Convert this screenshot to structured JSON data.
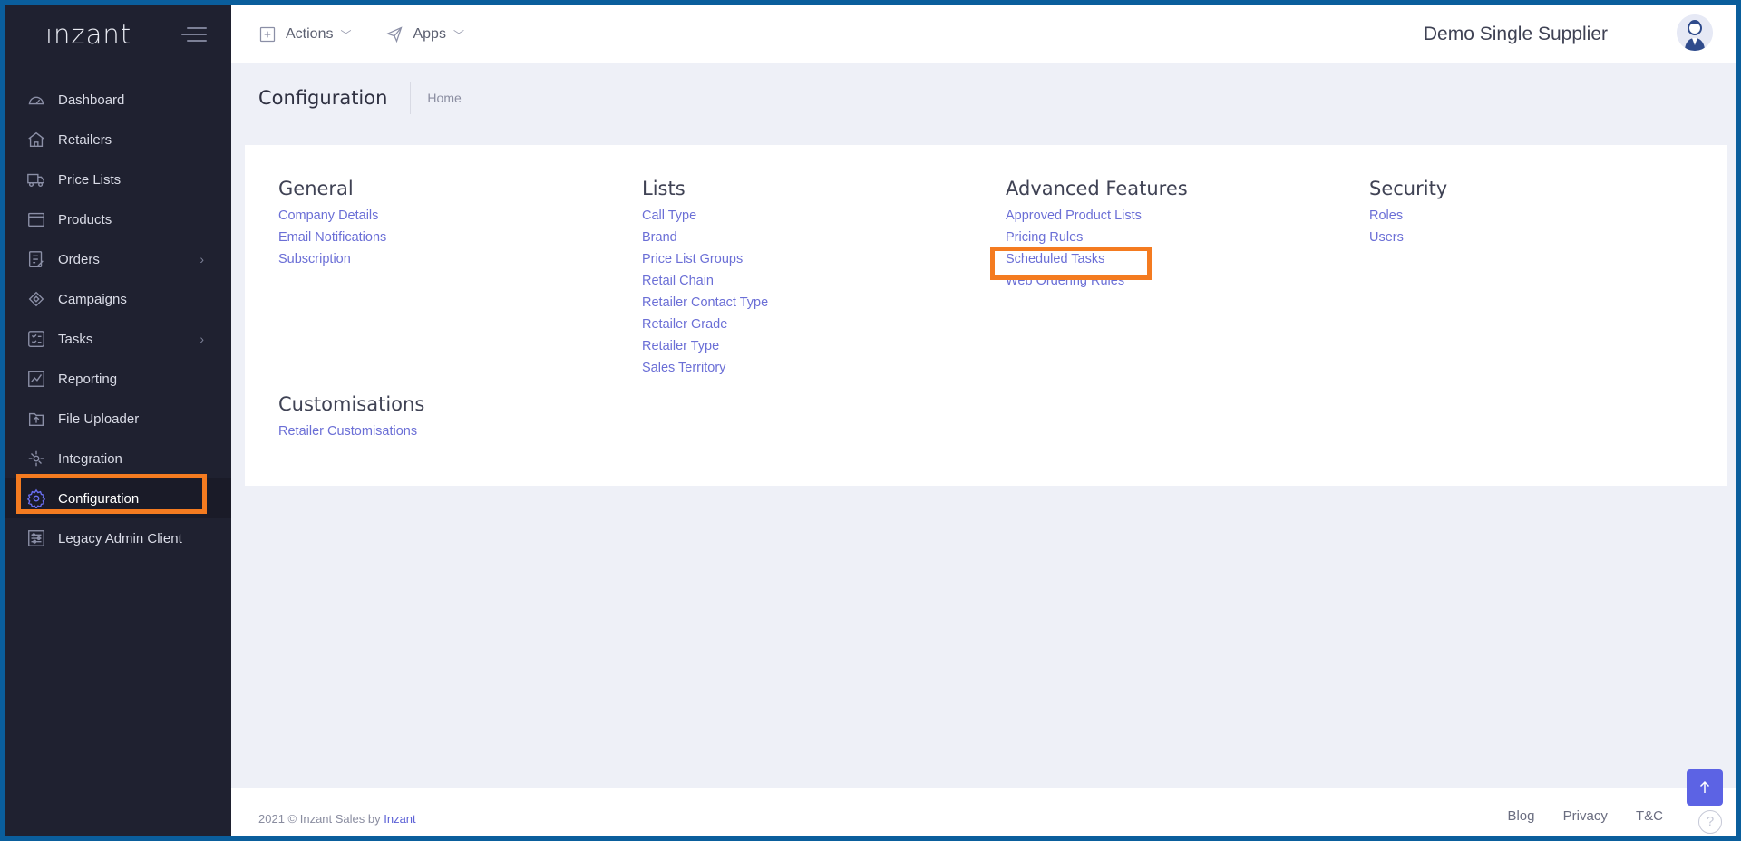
{
  "app": {
    "logo": "ınzant"
  },
  "sidebar": {
    "items": [
      {
        "label": "Dashboard",
        "icon": "dashboard-icon"
      },
      {
        "label": "Retailers",
        "icon": "home-icon"
      },
      {
        "label": "Price Lists",
        "icon": "truck-icon"
      },
      {
        "label": "Products",
        "icon": "box-icon"
      },
      {
        "label": "Orders",
        "icon": "orders-icon"
      },
      {
        "label": "Campaigns",
        "icon": "campaign-icon"
      },
      {
        "label": "Tasks",
        "icon": "tasks-icon"
      },
      {
        "label": "Reporting",
        "icon": "chart-icon"
      },
      {
        "label": "File Uploader",
        "icon": "upload-icon"
      },
      {
        "label": "Integration",
        "icon": "integration-icon"
      },
      {
        "label": "Configuration",
        "icon": "gear-icon"
      },
      {
        "label": "Legacy Admin Client",
        "icon": "sliders-icon"
      }
    ]
  },
  "header": {
    "actions_label": "Actions",
    "apps_label": "Apps",
    "supplier": "Demo Single Supplier"
  },
  "subheader": {
    "title": "Configuration",
    "breadcrumb": "Home"
  },
  "config": {
    "general": {
      "title": "General",
      "links": [
        "Company Details",
        "Email Notifications",
        "Subscription"
      ]
    },
    "lists": {
      "title": "Lists",
      "links": [
        "Call Type",
        "Brand",
        "Price List Groups",
        "Retail Chain",
        "Retailer Contact Type",
        "Retailer Grade",
        "Retailer Type",
        "Sales Territory"
      ]
    },
    "advanced": {
      "title": "Advanced Features",
      "links": [
        "Approved Product Lists",
        "Pricing Rules",
        "Scheduled Tasks",
        "Web Ordering Rules"
      ]
    },
    "security": {
      "title": "Security",
      "links": [
        "Roles",
        "Users"
      ]
    },
    "customisations": {
      "title": "Customisations",
      "links": [
        "Retailer Customisations"
      ]
    }
  },
  "footer": {
    "copyright": "2021 © Inzant Sales by",
    "company": "Inzant",
    "links": [
      "Blog",
      "Privacy",
      "T&C"
    ],
    "help": "?"
  },
  "colors": {
    "sidebar_bg": "#1f2130",
    "accent": "#6b6fd6",
    "highlight": "#f47b20",
    "frame": "#0a5e9c"
  }
}
